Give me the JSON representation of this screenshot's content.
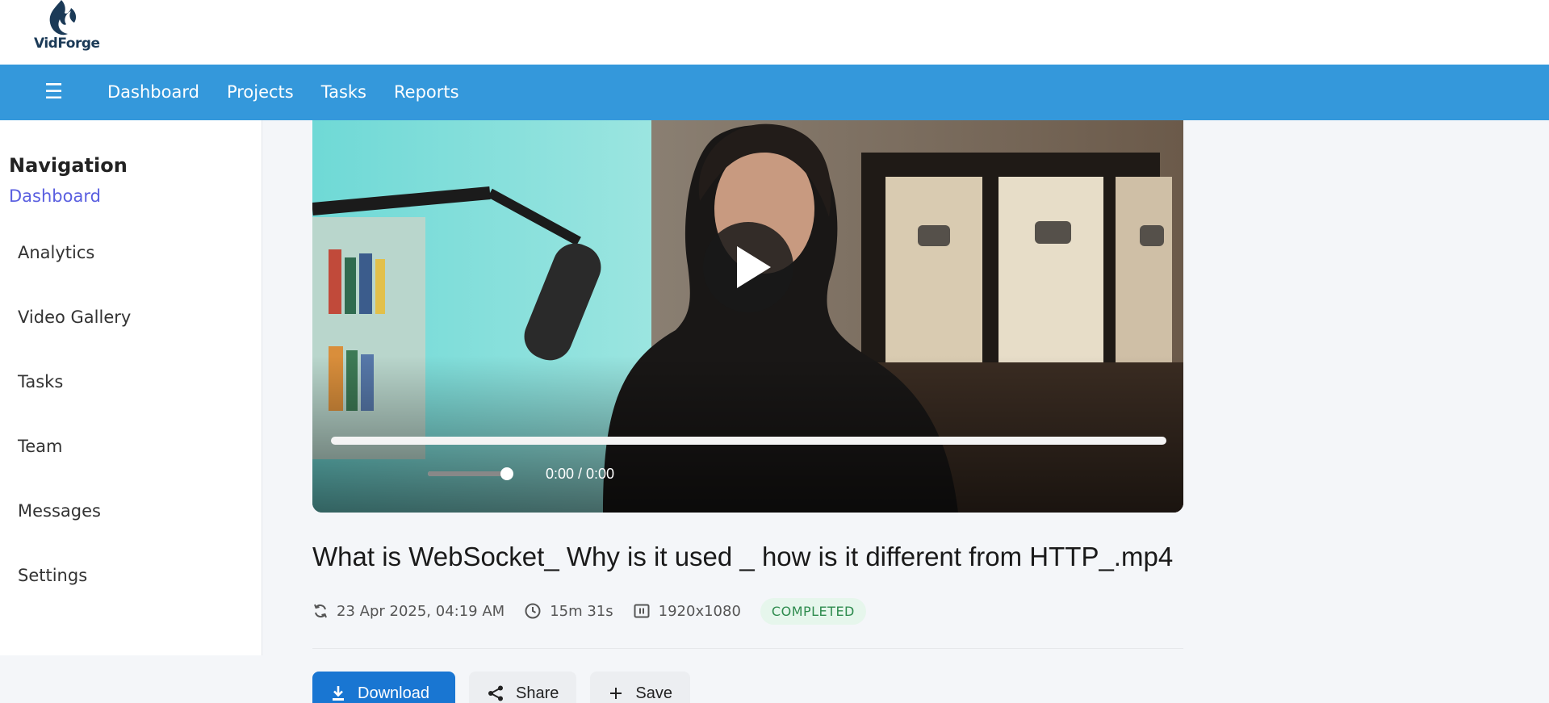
{
  "app": {
    "name": "VidForge"
  },
  "nav": {
    "links": [
      "Dashboard",
      "Projects",
      "Tasks",
      "Reports"
    ]
  },
  "sidebar": {
    "title": "Navigation",
    "active": "Dashboard",
    "items": [
      "Analytics",
      "Video Gallery",
      "Tasks",
      "Team",
      "Messages",
      "Settings"
    ]
  },
  "player": {
    "time": "0:00 / 0:00",
    "progress": 0,
    "volume": 1.0
  },
  "video": {
    "title": "What is WebSocket_ Why is it used _ how is it different from HTTP_.mp4",
    "date": "23 Apr 2025, 04:19 AM",
    "duration": "15m 31s",
    "resolution": "1920x1080",
    "status": "COMPLETED"
  },
  "actions": {
    "download": "Download",
    "share": "Share",
    "save": "Save"
  },
  "colors": {
    "navbar": "#3498db",
    "primary": "#1976d2",
    "active_link": "#5a5fe0",
    "badge_bg": "#e6f6ec",
    "badge_text": "#2e8b4e"
  }
}
